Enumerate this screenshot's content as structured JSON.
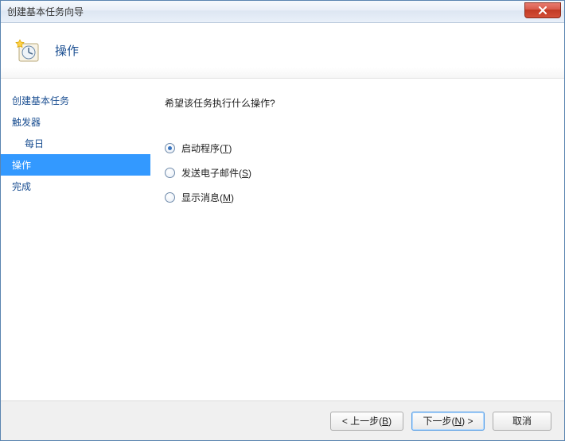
{
  "window": {
    "title": "创建基本任务向导"
  },
  "header": {
    "title": "操作"
  },
  "sidebar": {
    "items": [
      {
        "label": "创建基本任务",
        "indent": false,
        "selected": false
      },
      {
        "label": "触发器",
        "indent": false,
        "selected": false
      },
      {
        "label": "每日",
        "indent": true,
        "selected": false
      },
      {
        "label": "操作",
        "indent": false,
        "selected": true
      },
      {
        "label": "完成",
        "indent": false,
        "selected": false
      }
    ]
  },
  "main": {
    "prompt": "希望该任务执行什么操作?",
    "options": [
      {
        "label_pre": "启动程序(",
        "accel": "T",
        "label_post": ")",
        "checked": true
      },
      {
        "label_pre": "发送电子邮件(",
        "accel": "S",
        "label_post": ")",
        "checked": false
      },
      {
        "label_pre": "显示消息(",
        "accel": "M",
        "label_post": ")",
        "checked": false
      }
    ]
  },
  "footer": {
    "back_pre": "< 上一步(",
    "back_accel": "B",
    "back_post": ")",
    "next_pre": "下一步(",
    "next_accel": "N",
    "next_post": ") >",
    "cancel": "取消"
  }
}
